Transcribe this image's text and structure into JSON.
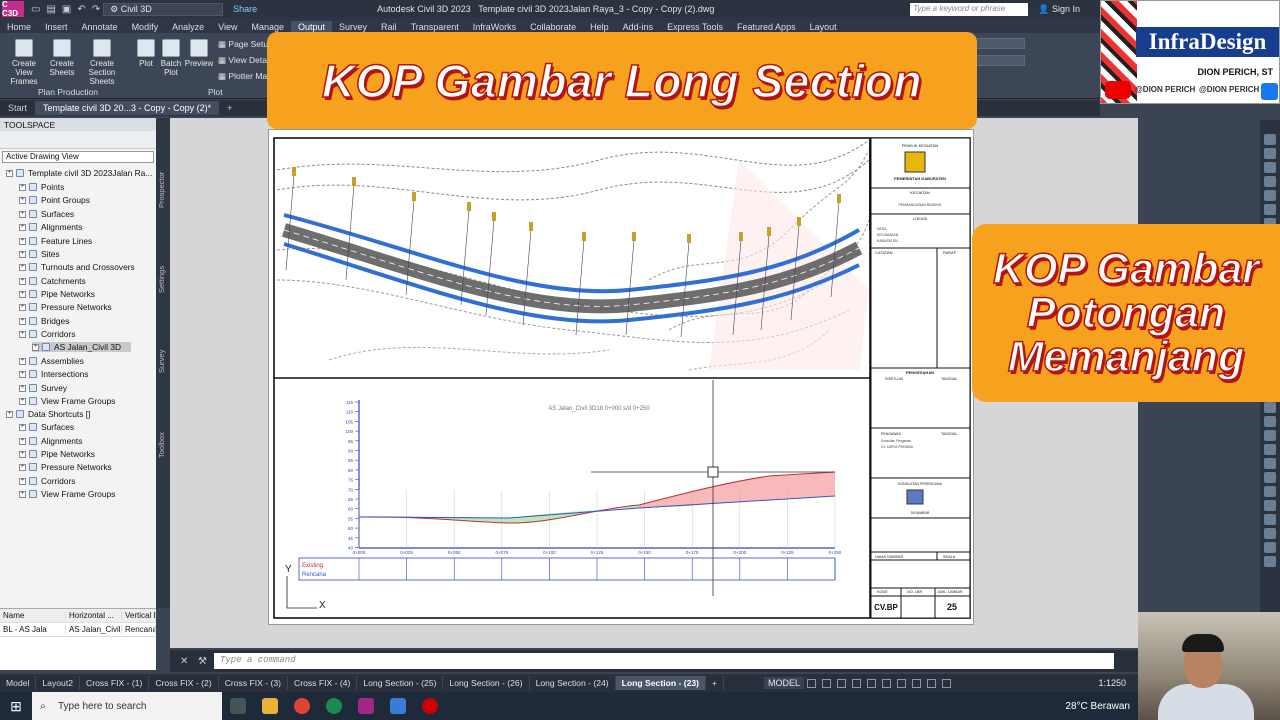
{
  "titlebar": {
    "workspace": "Civil 3D",
    "share": "Share",
    "app_title": "Autodesk Civil 3D 2023",
    "document": "Template civil 3D 2023Jalan Raya_3 - Copy - Copy (2).dwg",
    "search_placeholder": "Type a keyword or phrase",
    "sign_in": "Sign In"
  },
  "ribbon_tabs": [
    "Home",
    "Insert",
    "Annotate",
    "Modify",
    "Analyze",
    "View",
    "Manage",
    "Output",
    "Survey",
    "Rail",
    "Transparent",
    "InfraWorks",
    "Collaborate",
    "Help",
    "Add-ins",
    "Express Tools",
    "Featured Apps",
    "Layout"
  ],
  "ribbon_active_tab": "Output",
  "ribbon": {
    "create_view_frames": "Create View Frames",
    "create_sheets": "Create Sheets",
    "create_section_sheets": "Create Section Sheets",
    "panel_plan_production": "Plan Production",
    "plot": "Plot",
    "batch_plot": "Batch Plot",
    "preview": "Preview",
    "page_setup": "Page Setu",
    "view_details": "View Deta",
    "plotter_manager": "Plotter Ma",
    "panel_plot": "Plot"
  },
  "doc_tabs": [
    "Start",
    "Template civil 3D 20...3 - Copy - Copy (2)*"
  ],
  "toolspace": {
    "header": "TOOLSPACE",
    "view_select": "Active Drawing View",
    "tree": [
      {
        "label": "Template civil 3D 2023Jalan Ra...",
        "level": 0,
        "y": 172
      },
      {
        "label": "Points",
        "level": 1,
        "y": 186
      },
      {
        "label": "Point Groups",
        "level": 1,
        "y": 199
      },
      {
        "label": "Surfaces",
        "level": 1,
        "y": 213
      },
      {
        "label": "Alignments",
        "level": 1,
        "y": 226
      },
      {
        "label": "Feature Lines",
        "level": 1,
        "y": 240
      },
      {
        "label": "Sites",
        "level": 1,
        "y": 253
      },
      {
        "label": "Turnouts and Crossovers",
        "level": 1,
        "y": 266
      },
      {
        "label": "Catchments",
        "level": 1,
        "y": 280
      },
      {
        "label": "Pipe Networks",
        "level": 1,
        "y": 293
      },
      {
        "label": "Pressure Networks",
        "level": 1,
        "y": 306
      },
      {
        "label": "Bridges",
        "level": 1,
        "y": 320
      },
      {
        "label": "Corridors",
        "level": 1,
        "y": 333
      },
      {
        "label": "AS Jalan_Civil 3D",
        "level": 2,
        "y": 346,
        "highlight": true
      },
      {
        "label": "Assemblies",
        "level": 1,
        "y": 360
      },
      {
        "label": "Intersections",
        "level": 1,
        "y": 373
      },
      {
        "label": "Survey",
        "level": 1,
        "y": 387
      },
      {
        "label": "View Frame Groups",
        "level": 1,
        "y": 400
      },
      {
        "label": "Data Shortcuts []",
        "level": 0,
        "y": 413
      },
      {
        "label": "Surfaces",
        "level": 1,
        "y": 426
      },
      {
        "label": "Alignments",
        "level": 1,
        "y": 440
      },
      {
        "label": "Pipe Networks",
        "level": 1,
        "y": 453
      },
      {
        "label": "Pressure Networks",
        "level": 1,
        "y": 466
      },
      {
        "label": "Corridors",
        "level": 1,
        "y": 480
      },
      {
        "label": "View Frame Groups",
        "level": 1,
        "y": 493
      }
    ],
    "side_tabs": [
      "Prospector",
      "Settings",
      "Survey",
      "Toolbox"
    ]
  },
  "properties": {
    "headers": [
      "Name",
      "Horizontal ...",
      "Vertical B"
    ],
    "row": [
      "BL - AS Jala",
      "AS Jalan_Civil",
      "Rencana_"
    ]
  },
  "banner_main": "KOP Gambar Long Section",
  "banner_side": [
    "KOP Gambar",
    "Potongan",
    "Memanjang"
  ],
  "brand": {
    "name": "InfraDesign",
    "person": "DION PERICH, ST",
    "youtube": "@DION PERICH",
    "facebook": "@DION PERICH"
  },
  "sheet": {
    "profile_title": "AS Jalan_Civil 3D18 0+000 s/d 0+250",
    "legend_existing": "Existing",
    "legend_rencana": "Rencana",
    "y_ticks": [
      "115",
      "110",
      "105",
      "100",
      "95",
      "90",
      "85",
      "80",
      "75",
      "70",
      "65",
      "60",
      "55",
      "50",
      "45",
      "40"
    ],
    "x_ticks": [
      "0+000",
      "0+025",
      "0+050",
      "0+075",
      "0+100",
      "0+125",
      "0+150",
      "0+175",
      "0+200",
      "0+225",
      "0+250"
    ],
    "title_block": {
      "pemilik": "PEMILIK KEGIATAN",
      "pemerintah": "PEMERINTAH KABUPATEN",
      "kegiatan": "KEGIATAN",
      "pembangunan": "PEMBANGUNAN BINDING",
      "lokasi": "LOKASI",
      "desa": "DESA",
      "kecamatan": "KECAMATAN",
      "kabupaten": "KABUPATEN",
      "catatan": "CATATAN",
      "paraf": "PARAF",
      "pengesahan": "PENGESAHAN",
      "disetujui": "DISETUJUI",
      "tanggal": "TANGGAL",
      "pengawas": "PENGAWAS",
      "konsultan_pengawas": "Konsultan Pengawas",
      "cv": "CV. KARYA PRATAMA",
      "konsultan_perencana": "KONSULTAN PERENCANA",
      "digambar": "DIGAMBAR",
      "nama_gambar": "NAMA GAMBAR",
      "skala": "SKALA",
      "kode": "KODE",
      "no_lbr": "NO. LBR",
      "jml_lembar": "JUML. LEMBAR",
      "kode_value": "CV.BP",
      "jml_value": "25"
    }
  },
  "command_placeholder": "Type a command",
  "layout_tabs": [
    "Model",
    "Layout2",
    "Cross FIX - (1)",
    "Cross FIX - (2)",
    "Cross FIX - (3)",
    "Cross FIX - (4)",
    "Long Section - (25)",
    "Long Section - (26)",
    "Long Section - (24)",
    "Long Section - (23)"
  ],
  "layout_active": "Long Section - (23)",
  "status": {
    "model": "MODEL",
    "scale": "1:1250"
  },
  "taskbar": {
    "search": "Type here to search",
    "weather": "28°C Berawan"
  }
}
